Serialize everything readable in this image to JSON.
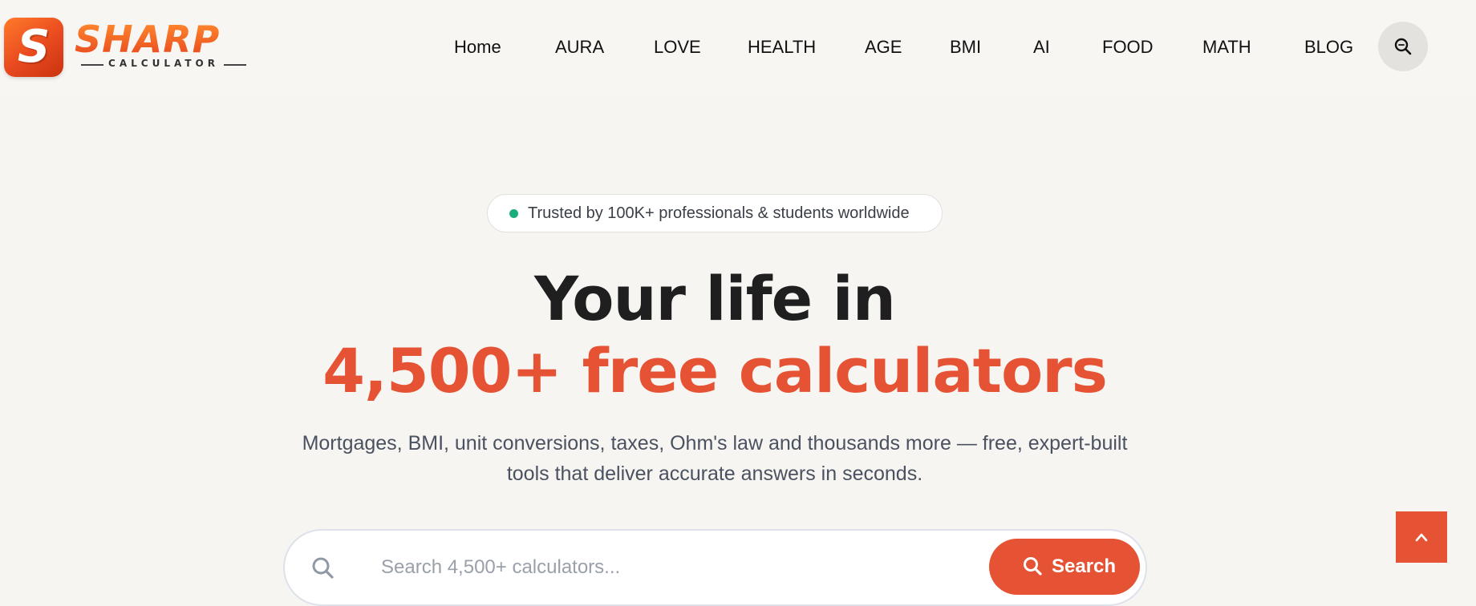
{
  "brand": {
    "logo_letter": "S",
    "name": "SHARP",
    "tagline": "CALCULATOR",
    "accent": "#e65234"
  },
  "nav": {
    "items": [
      {
        "label": "Home"
      },
      {
        "label": "AURA"
      },
      {
        "label": "LOVE"
      },
      {
        "label": "HEALTH"
      },
      {
        "label": "AGE"
      },
      {
        "label": "BMI"
      },
      {
        "label": "AI"
      },
      {
        "label": "FOOD"
      },
      {
        "label": "MATH"
      },
      {
        "label": "BLOG"
      }
    ],
    "search_icon": "search-icon"
  },
  "hero": {
    "badge_text": "Trusted by 100K+ professionals & students worldwide",
    "badge_dot_color": "#1cae7a",
    "headline_line1": "Your life in",
    "headline_line2": "4,500+ free calculators",
    "subtitle": "Mortgages, BMI, unit conversions, taxes, Ohm's law and thousands more — free, expert-built tools that deliver accurate answers in seconds."
  },
  "search": {
    "placeholder": "Search 4,500+ calculators...",
    "value": "",
    "button_label": "Search",
    "icon": "search-icon"
  },
  "back_to_top": {
    "icon": "chevron-up-icon"
  }
}
